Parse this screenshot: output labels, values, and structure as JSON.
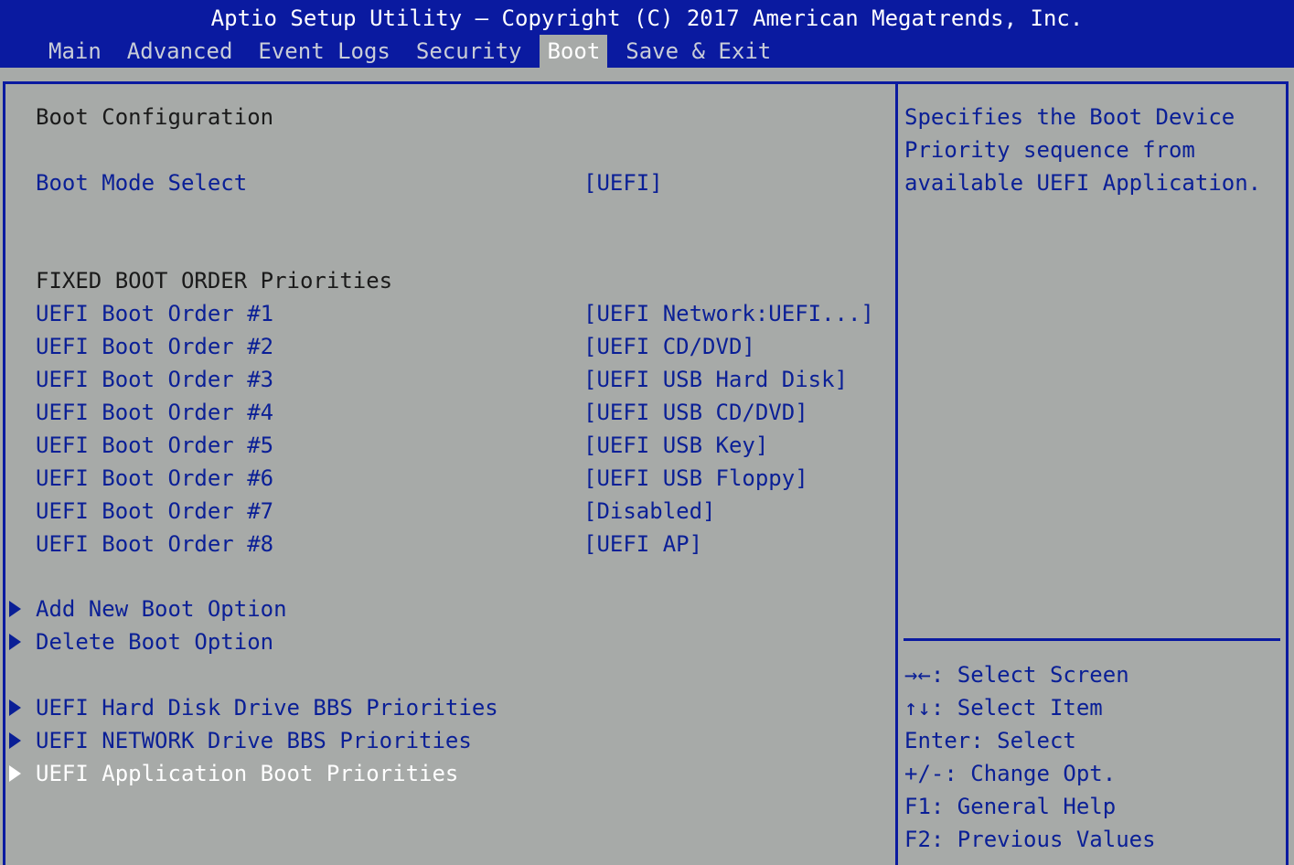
{
  "header": {
    "title": "Aptio Setup Utility – Copyright (C) 2017 American Megatrends, Inc.",
    "tabs": [
      "Main",
      "Advanced",
      "Event Logs",
      "Security",
      "Boot",
      "Save & Exit"
    ],
    "active_tab": "Boot"
  },
  "boot": {
    "heading": "Boot Configuration",
    "boot_mode_label": "Boot Mode Select",
    "boot_mode_value": "[UEFI]",
    "fixed_heading": "FIXED BOOT ORDER Priorities",
    "orders": [
      {
        "label": "UEFI Boot Order #1",
        "value": "[UEFI Network:UEFI...]"
      },
      {
        "label": "UEFI Boot Order #2",
        "value": "[UEFI CD/DVD]"
      },
      {
        "label": "UEFI Boot Order #3",
        "value": "[UEFI USB Hard Disk]"
      },
      {
        "label": "UEFI Boot Order #4",
        "value": "[UEFI USB CD/DVD]"
      },
      {
        "label": "UEFI Boot Order #5",
        "value": "[UEFI USB Key]"
      },
      {
        "label": "UEFI Boot Order #6",
        "value": "[UEFI USB Floppy]"
      },
      {
        "label": "UEFI Boot Order #7",
        "value": "[Disabled]"
      },
      {
        "label": "UEFI Boot Order #8",
        "value": "[UEFI AP]"
      }
    ],
    "submenus": [
      "Add New Boot Option",
      "Delete Boot Option",
      "UEFI Hard Disk Drive BBS Priorities",
      "UEFI NETWORK Drive BBS Priorities",
      "UEFI Application Boot Priorities"
    ]
  },
  "help": {
    "lines": [
      "Specifies the Boot Device",
      "Priority sequence from",
      "available UEFI Application."
    ]
  },
  "keys": [
    "→←: Select Screen",
    "↑↓: Select Item",
    "Enter: Select",
    "+/-: Change Opt.",
    "F1: General Help",
    "F2: Previous Values"
  ],
  "colors": {
    "bar_blue": "#0a1aa0",
    "panel_gray": "#a7aaa8",
    "item_blue": "#0a1f96"
  }
}
